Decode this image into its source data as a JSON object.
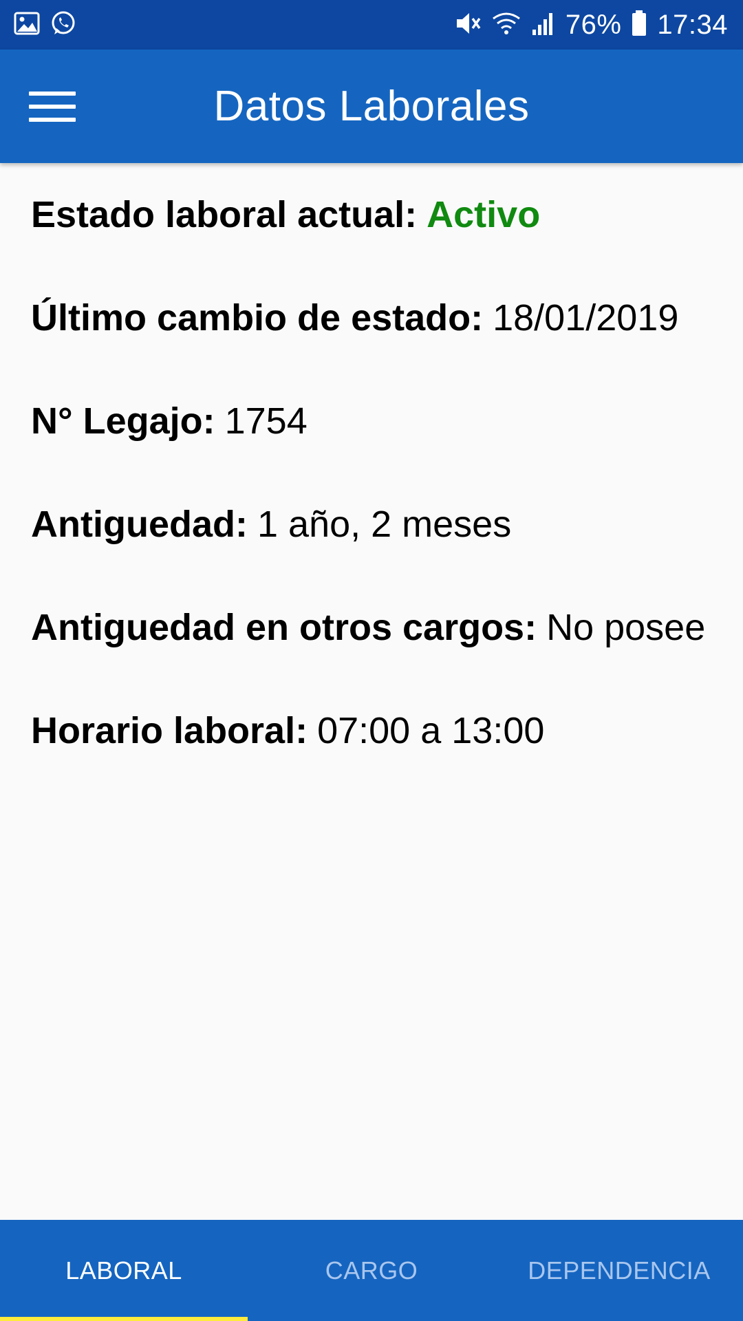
{
  "status_bar": {
    "battery_percent": "76%",
    "time": "17:34",
    "icons_left": [
      "gallery-icon",
      "whatsapp-icon"
    ],
    "icons_right": [
      "mute-icon",
      "wifi-icon",
      "signal-icon",
      "battery-icon"
    ]
  },
  "app_bar": {
    "title": "Datos Laborales",
    "menu_icon": "hamburger-menu-icon"
  },
  "fields": [
    {
      "label": "Estado laboral actual:",
      "value": "Activo"
    },
    {
      "label": "Último cambio de estado:",
      "value": "18/01/2019"
    },
    {
      "label": "N° Legajo:",
      "value": "1754"
    },
    {
      "label": "Antiguedad:",
      "value": "1 año, 2 meses"
    },
    {
      "label": "Antiguedad en otros cargos:",
      "value": "No posee"
    },
    {
      "label": "Horario laboral:",
      "value": "07:00 a 13:00"
    }
  ],
  "bottom_nav": {
    "tabs": [
      {
        "label": "LABORAL",
        "active": true
      },
      {
        "label": "CARGO",
        "active": false
      },
      {
        "label": "DEPENDENCIA",
        "active": false
      }
    ]
  },
  "colors": {
    "status_bar": "#0d47a1",
    "primary": "#1565c0",
    "status_active": "#108a10",
    "tab_indicator": "#ffeb3b"
  }
}
